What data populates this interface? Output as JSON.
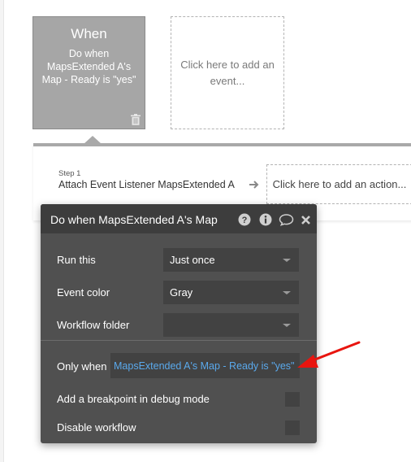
{
  "event": {
    "when_label": "When",
    "description": "Do when MapsExtended A's Map - Ready is \"yes\"",
    "add_event_text": "Click here to add an event..."
  },
  "step": {
    "number_label": "Step 1",
    "title": "Attach Event Listener MapsExtended A",
    "add_action_text": "Click here to add an action..."
  },
  "panel": {
    "title": "Do when MapsExtended A's Map",
    "icons": [
      "help-icon",
      "info-icon",
      "comment-icon",
      "close-icon"
    ],
    "run_this": {
      "label": "Run this",
      "value": "Just once"
    },
    "event_color": {
      "label": "Event color",
      "value": "Gray"
    },
    "workflow_folder": {
      "label": "Workflow folder",
      "value": ""
    },
    "only_when": {
      "label": "Only when",
      "value": "MapsExtended A's Map - Ready is \"yes\""
    },
    "breakpoint": {
      "label": "Add a breakpoint in debug mode",
      "checked": false
    },
    "disable": {
      "label": "Disable workflow",
      "checked": false
    }
  },
  "colors": {
    "event_card": "#a6a6a6",
    "panel_bg": "#505050",
    "panel_header": "#3d3d3d",
    "condition_text": "#5aa9ec",
    "annotation_arrow": "#e8150f"
  }
}
